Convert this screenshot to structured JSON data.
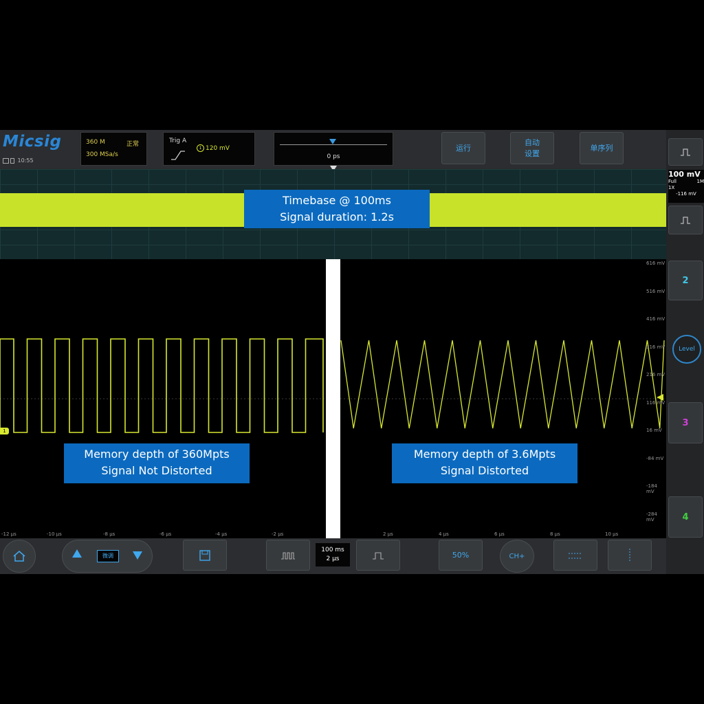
{
  "header": {
    "brand": "Micsig",
    "clock": "10:55",
    "acquisition": {
      "memory_depth": "360 M",
      "mode": "正常",
      "sample_rate": "300 MSa/s"
    },
    "trigger": {
      "label": "Trig A",
      "source": "1",
      "level": "120 mV"
    },
    "horizontal_position": {
      "value": "0 ps"
    },
    "buttons": {
      "run": "运行",
      "auto_setup": "自动\n设置",
      "single": "单序列"
    }
  },
  "overview": {
    "callout_line1": "Timebase @ 100ms",
    "callout_line2": "Signal duration: 1.2s"
  },
  "waveform": {
    "left_callout_line1": "Memory depth of 360Mpts",
    "left_callout_line2": "Signal Not Distorted",
    "right_callout_line1": "Memory depth of 3.6Mpts",
    "right_callout_line2": "Signal Distorted",
    "channel_marker": "1",
    "y_ticks": [
      "616 mV",
      "516 mV",
      "416 mV",
      "316 mV",
      "216 mV",
      "116 mV",
      "16 mV",
      "-84 mV",
      "-184 mV",
      "-284 mV",
      "-384 mV"
    ],
    "x_ticks": [
      "-12 µs",
      "-10 µs",
      "-8 µs",
      "-6 µs",
      "-4 µs",
      "-2 µs",
      "2 µs",
      "4 µs",
      "6 µs",
      "8 µs",
      "10 µs"
    ]
  },
  "side_panel": {
    "ch1_scale": "100 mV",
    "ch1_info": [
      "Full",
      "1M",
      "1X",
      "-116 mV"
    ],
    "ch2": "2",
    "level": "Level",
    "ch3": "3",
    "ch4": "4"
  },
  "bottom_bar": {
    "fine_label": "微调",
    "timebase_main": "100 ms",
    "timebase_zoom": "2 µs",
    "fifty_percent": "50%",
    "ch_button": "CH+"
  },
  "colors": {
    "ch1_trace": "#d8e830",
    "overview_band": "#c8e22a",
    "callout_bg": "#0b6abf",
    "accent_blue": "#3fa8ee",
    "ch2": "#3fc8e8",
    "ch3": "#d040d8",
    "ch4": "#40d040"
  }
}
